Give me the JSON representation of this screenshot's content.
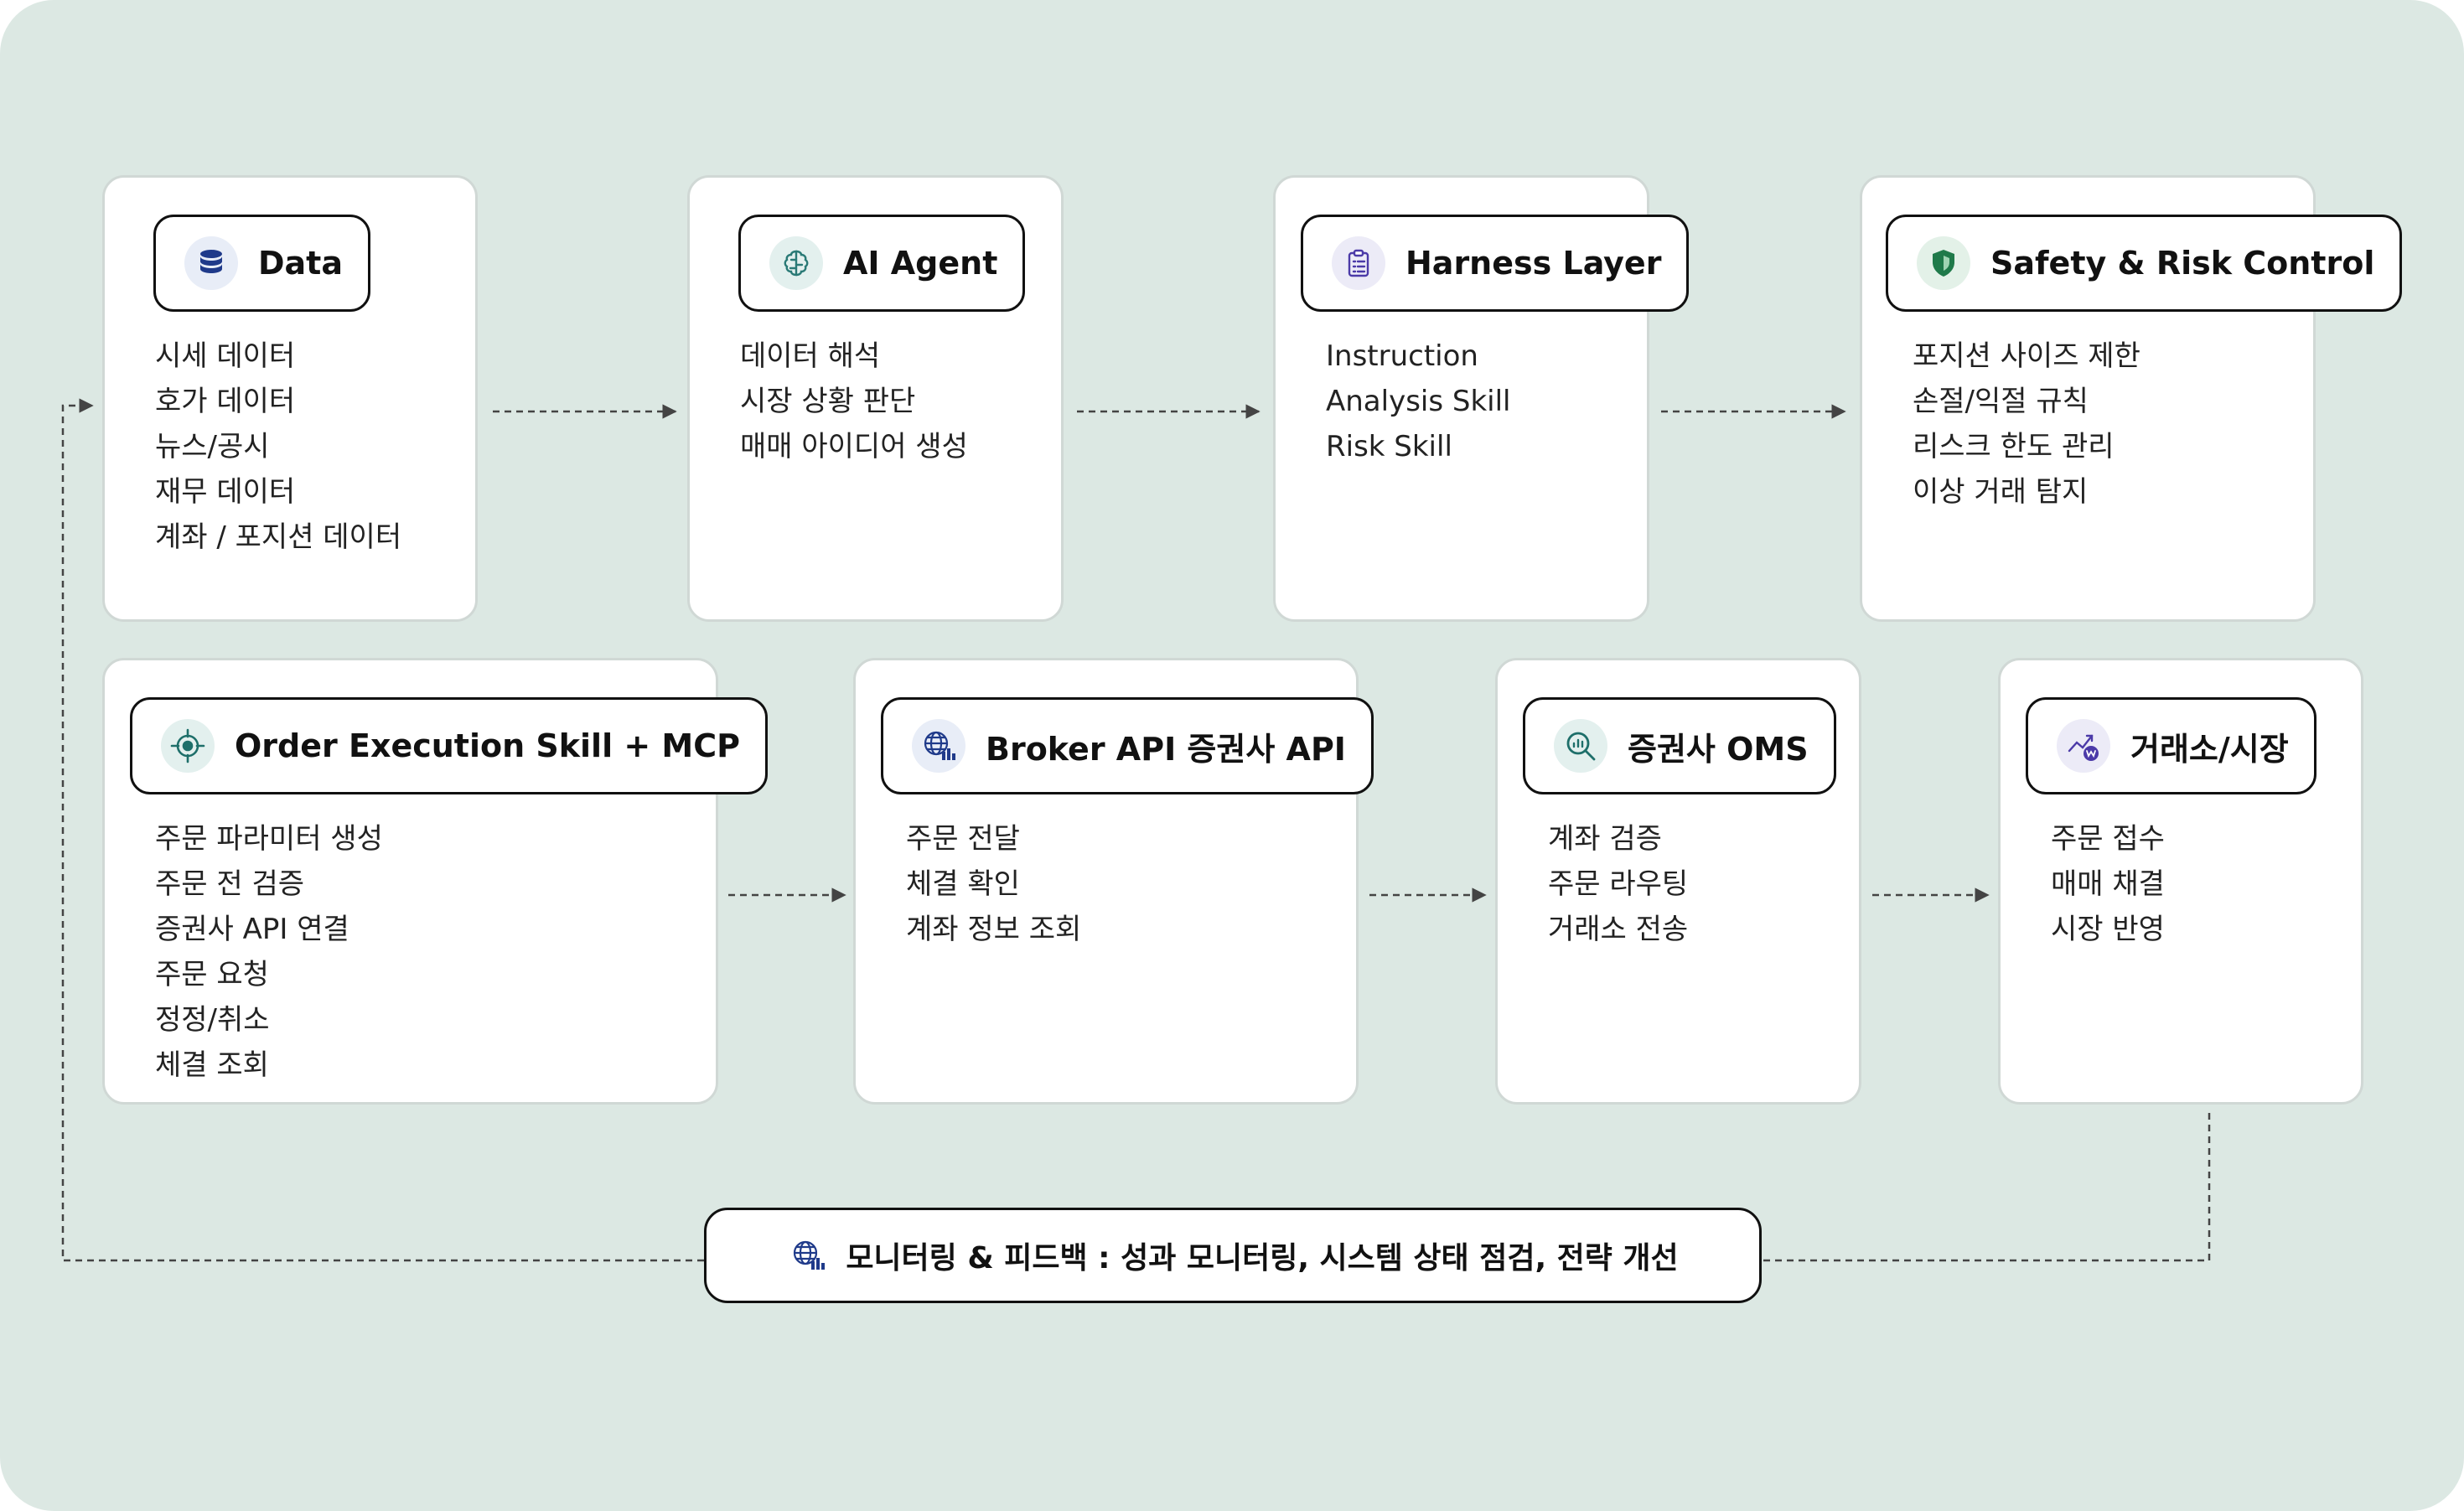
{
  "top_row": [
    {
      "title": "Data",
      "icon": "database-icon",
      "items": [
        "시세 데이터",
        "호가 데이터",
        "뉴스/공시",
        "재무 데이터",
        "계좌 / 포지션 데이터"
      ]
    },
    {
      "title": "AI Agent",
      "icon": "brain-icon",
      "items": [
        "데이터 해석",
        "시장 상황 판단",
        "매매 아이디어 생성"
      ]
    },
    {
      "title": "Harness Layer",
      "icon": "clipboard-icon",
      "items": [
        "Instruction",
        "Analysis Skill",
        "Risk Skill"
      ]
    },
    {
      "title": "Safety & Risk Control",
      "icon": "shield-icon",
      "items": [
        "포지션 사이즈 제한",
        "손절/익절 규칙",
        "리스크 한도 관리",
        "이상 거래 탐지"
      ]
    }
  ],
  "bottom_row": [
    {
      "title": "Order Execution Skill + MCP",
      "icon": "target-icon",
      "items": [
        "주문 파라미터 생성",
        "주문 전 검증",
        "증권사 API 연결",
        "주문 요청",
        "정정/취소",
        "체결 조회"
      ]
    },
    {
      "title": "Broker API 증권사 API",
      "icon": "globe-chart-icon",
      "items": [
        "주문 전달",
        "체결 확인",
        "계좌 정보 조회"
      ]
    },
    {
      "title": "증권사 OMS",
      "icon": "magnifier-chart-icon",
      "items": [
        "계좌 검증",
        "주문 라우팅",
        "거래소 전송"
      ]
    },
    {
      "title": "거래소/시장",
      "icon": "exchange-icon",
      "items": [
        "주문 접수",
        "매매 채결",
        "시장 반영"
      ]
    }
  ],
  "monitoring": {
    "icon": "globe-chart-icon",
    "text": "모니터링 & 피드백 : 성과 모니터링, 시스템 상태 점검, 전략 개선"
  },
  "colors": {
    "background": "#dce8e3",
    "card": "#ffffff",
    "card_border": "#d0d8d5",
    "pill_border": "#111111",
    "connector": "#444444",
    "database": "#1f3a8a",
    "brain": "#2a7a76",
    "clipboard": "#4b3aa8",
    "shield": "#1f7a4a",
    "target": "#1e6f6a",
    "globe": "#1f3a8a",
    "exchange": "#4b3aa8"
  }
}
